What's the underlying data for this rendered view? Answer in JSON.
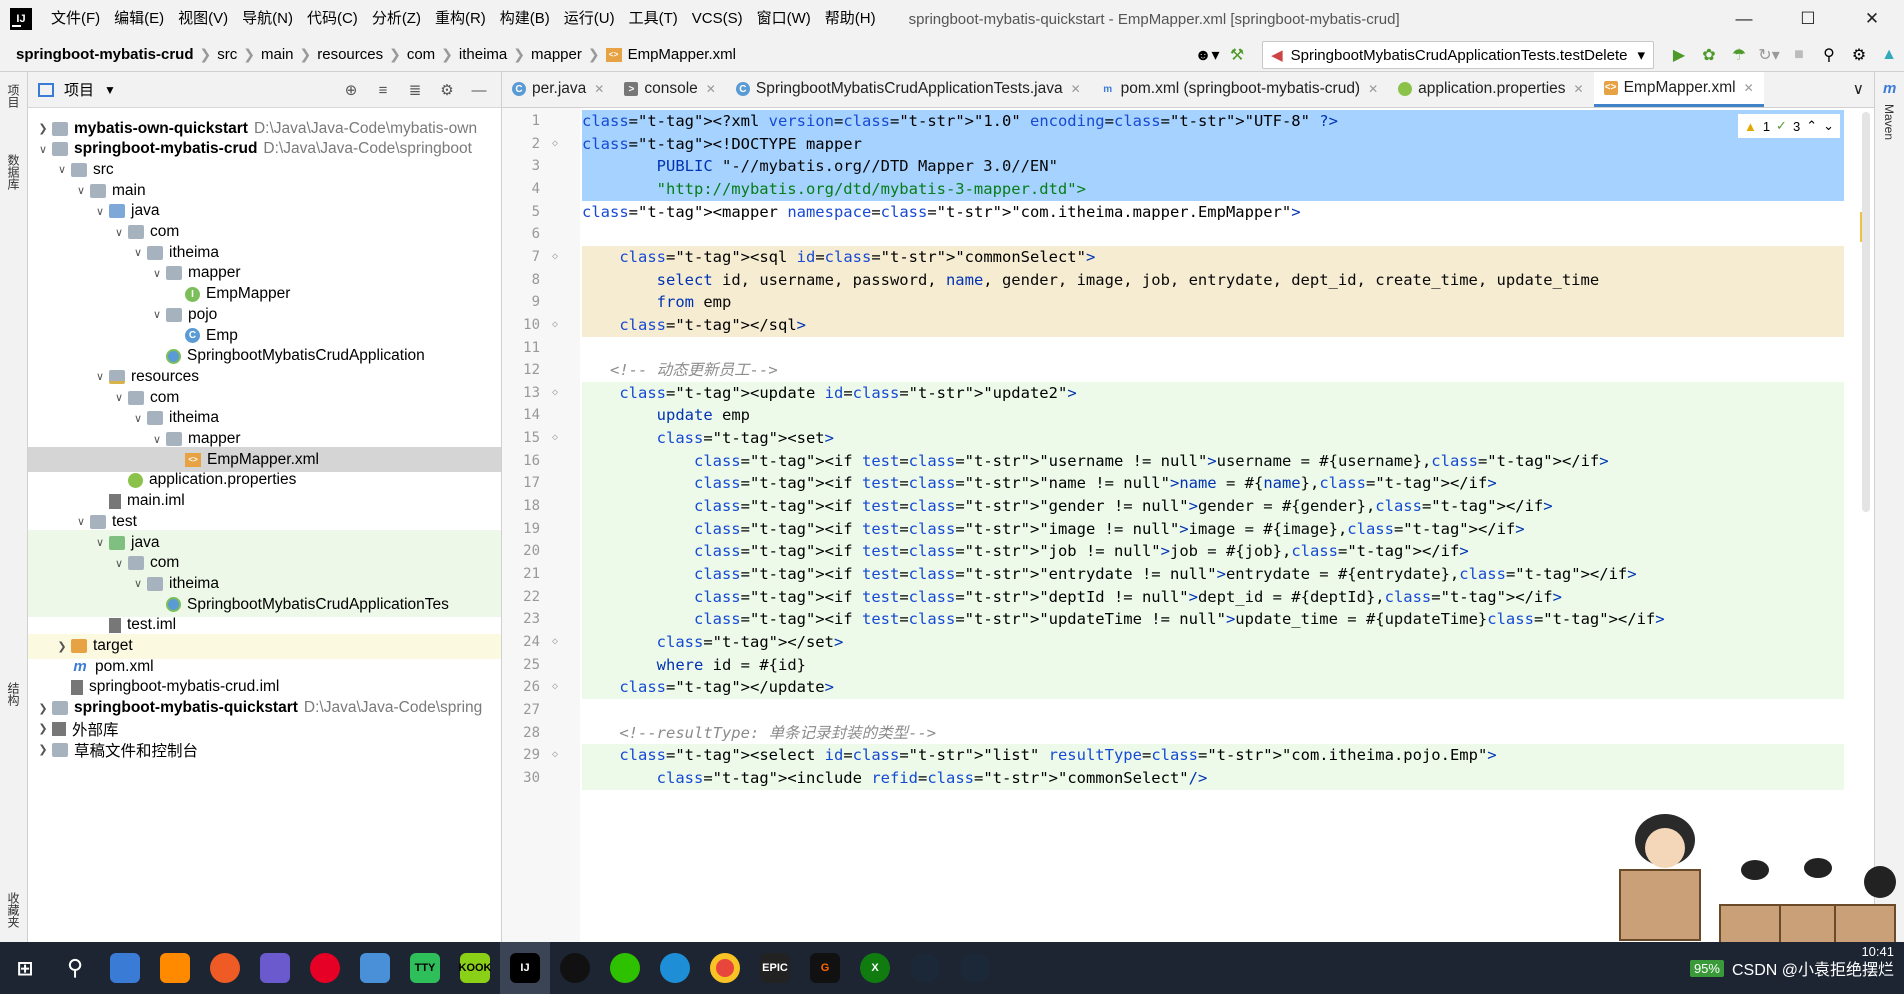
{
  "menubar": {
    "items": [
      "文件(F)",
      "编辑(E)",
      "视图(V)",
      "导航(N)",
      "代码(C)",
      "分析(Z)",
      "重构(R)",
      "构建(B)",
      "运行(U)",
      "工具(T)",
      "VCS(S)",
      "窗口(W)",
      "帮助(H)"
    ],
    "window_title": "springboot-mybatis-quickstart - EmpMapper.xml [springboot-mybatis-crud]"
  },
  "breadcrumb": [
    "springboot-mybatis-crud",
    "src",
    "main",
    "resources",
    "com",
    "itheima",
    "mapper",
    "EmpMapper.xml"
  ],
  "run_config": "SpringbootMybatisCrudApplicationTests.testDelete",
  "left_strip": {
    "project": "项目",
    "database": "数据库",
    "structure": "结构",
    "favorites": "收藏夹"
  },
  "right_strip": {
    "maven": "Maven"
  },
  "project_panel": {
    "title": "项目",
    "tree": [
      {
        "label": "mybatis-own-quickstart",
        "path": "D:\\Java\\Java-Code\\mybatis-own",
        "bold": true
      },
      {
        "label": "springboot-mybatis-crud",
        "path": "D:\\Java\\Java-Code\\springboot",
        "bold": true
      },
      {
        "label": "src"
      },
      {
        "label": "main"
      },
      {
        "label": "java"
      },
      {
        "label": "com"
      },
      {
        "label": "itheima"
      },
      {
        "label": "mapper"
      },
      {
        "label": "EmpMapper"
      },
      {
        "label": "pojo"
      },
      {
        "label": "Emp"
      },
      {
        "label": "SpringbootMybatisCrudApplication"
      },
      {
        "label": "resources"
      },
      {
        "label": "com"
      },
      {
        "label": "itheima"
      },
      {
        "label": "mapper"
      },
      {
        "label": "EmpMapper.xml"
      },
      {
        "label": "application.properties"
      },
      {
        "label": "main.iml"
      },
      {
        "label": "test"
      },
      {
        "label": "java"
      },
      {
        "label": "com"
      },
      {
        "label": "itheima"
      },
      {
        "label": "SpringbootMybatisCrudApplicationTes"
      },
      {
        "label": "test.iml"
      },
      {
        "label": "target"
      },
      {
        "label": "pom.xml"
      },
      {
        "label": "springboot-mybatis-crud.iml"
      },
      {
        "label": "springboot-mybatis-quickstart",
        "path": "D:\\Java\\Java-Code\\spring",
        "bold": true
      },
      {
        "label": "外部库"
      },
      {
        "label": "草稿文件和控制台"
      }
    ]
  },
  "editor_tabs": [
    {
      "label": "per.java"
    },
    {
      "label": "console"
    },
    {
      "label": "SpringbootMybatisCrudApplicationTests.java"
    },
    {
      "label": "pom.xml (springboot-mybatis-crud)"
    },
    {
      "label": "application.properties"
    },
    {
      "label": "EmpMapper.xml",
      "active": true
    }
  ],
  "inspections": {
    "warnings": "1",
    "weak": "3"
  },
  "code_lines": [
    "<?xml version=\"1.0\" encoding=\"UTF-8\" ?>",
    "<!DOCTYPE mapper",
    "        PUBLIC \"-//mybatis.org//DTD Mapper 3.0//EN\"",
    "        \"http://mybatis.org/dtd/mybatis-3-mapper.dtd\">",
    "<mapper namespace=\"com.itheima.mapper.EmpMapper\">",
    "",
    "    <sql id=\"commonSelect\">",
    "        select id, username, password, name, gender, image, job, entrydate, dept_id, create_time, update_time",
    "        from emp",
    "    </sql>",
    "",
    "   <!-- 动态更新员工-->",
    "    <update id=\"update2\">",
    "        update emp",
    "        <set>",
    "            <if test=\"username != null\">username = #{username},</if>",
    "            <if test=\"name != null\">name = #{name},</if>",
    "            <if test=\"gender != null\">gender = #{gender},</if>",
    "            <if test=\"image != null\">image = #{image},</if>",
    "            <if test=\"job != null\">job = #{job},</if>",
    "            <if test=\"entrydate != null\">entrydate = #{entrydate},</if>",
    "            <if test=\"deptId != null\">dept_id = #{deptId},</if>",
    "            <if test=\"updateTime != null\">update_time = #{updateTime}</if>",
    "        </set>",
    "        where id = #{id}",
    "    </update>",
    "",
    "    <!--resultType: 单条记录封装的类型-->",
    "    <select id=\"list\" resultType=\"com.itheima.pojo.Emp\">",
    "        <include refid=\"commonSelect\"/>"
  ],
  "taskbar": {
    "clock": "10:41",
    "battery": "95%",
    "watermark": "CSDN @小袁拒绝摆烂"
  },
  "colors": {
    "accent": "#4083c9",
    "selection": "#a6d2ff",
    "sql_block": "#f6ecd2",
    "update_block": "#edfaea"
  }
}
